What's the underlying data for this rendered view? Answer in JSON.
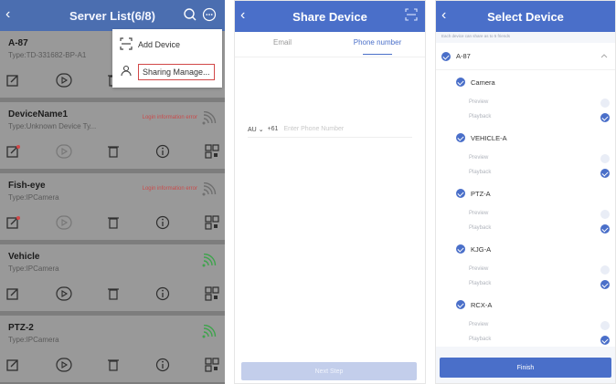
{
  "screen1": {
    "title": "Server List(6/8)",
    "menu": [
      {
        "label": "Add Device",
        "icon": "scan-icon"
      },
      {
        "label": "Sharing Manage...",
        "icon": "share-icon",
        "highlighted": true
      }
    ],
    "devices": [
      {
        "name": "A-87",
        "type": "Type:TD-331682-BP-A1",
        "error": "",
        "online": true
      },
      {
        "name": "DeviceName1",
        "type": "Type:Unknown Device Ty...",
        "error": "Login information error",
        "online": false
      },
      {
        "name": "Fish-eye",
        "type": "Type:IPCamera",
        "error": "Login information error",
        "online": false
      },
      {
        "name": "Vehicle",
        "type": "Type:IPCamera",
        "error": "",
        "online": true
      },
      {
        "name": "PTZ-2",
        "type": "Type:IPCamera",
        "error": "",
        "online": true
      }
    ],
    "colors": {
      "header": "#4b6eb0",
      "overlay": "#999999",
      "highlight": "#d24848",
      "online": "#3fa34d",
      "error": "#c94b4b"
    }
  },
  "screen2": {
    "title": "Share Device",
    "tabs": {
      "email": "Email",
      "phone": "Phone number"
    },
    "country_code": "AU",
    "prefix": "+61",
    "phone_placeholder": "Enter Phone Number",
    "next_label": "Next Step"
  },
  "screen3": {
    "title": "Select Device",
    "note": "Each device can share as to 5 friends",
    "group": "A-87",
    "devices": [
      {
        "name": "Camera",
        "preview": "Preview",
        "playback": "Playback"
      },
      {
        "name": "VEHICLE-A",
        "preview": "Preview",
        "playback": "Playback"
      },
      {
        "name": "PTZ-A",
        "preview": "Preview",
        "playback": "Playback"
      },
      {
        "name": "KJG-A",
        "preview": "Preview",
        "playback": "Playback"
      },
      {
        "name": "RCX-A",
        "preview": "Preview",
        "playback": "Playback"
      }
    ],
    "finish_label": "Finish",
    "accent": "#4a6fc9"
  }
}
